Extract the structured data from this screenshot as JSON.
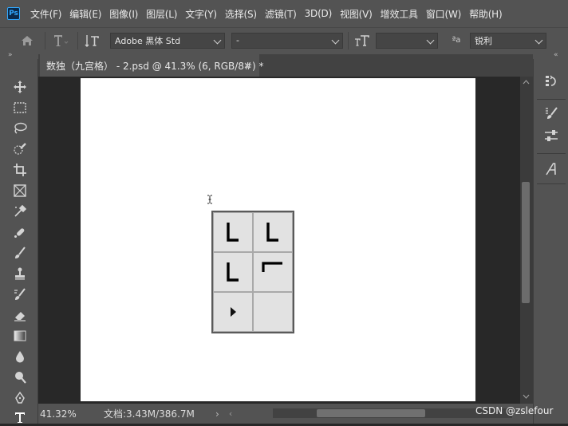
{
  "menu": [
    "文件(F)",
    "编辑(E)",
    "图像(I)",
    "图层(L)",
    "文字(Y)",
    "选择(S)",
    "滤镜(T)",
    "3D(D)",
    "视图(V)",
    "增效工具",
    "窗口(W)",
    "帮助(H)"
  ],
  "app_logo": "Ps",
  "options": {
    "font_family": "Adobe 黑体 Std",
    "font_style": "-",
    "font_size": "",
    "antialias_label": "ªa",
    "antialias": "锐利"
  },
  "tab": {
    "title": "数独（九宫格） - 2.psd @ 41.3% (6, RGB/8#) *",
    "close": "×"
  },
  "grid_cells": [
    "L",
    "L",
    "L",
    "corner",
    "play",
    ""
  ],
  "status": {
    "zoom": "41.32%",
    "doc_size": "文档:3.43M/386.7M",
    "arrow": "›"
  },
  "watermark": "CSDN @zslefour",
  "colors": {
    "chrome": "#535353",
    "workspace": "#282828",
    "canvas": "#ffffff",
    "grid_cell": "#e2e2e2",
    "accent": "#31a8ff"
  }
}
